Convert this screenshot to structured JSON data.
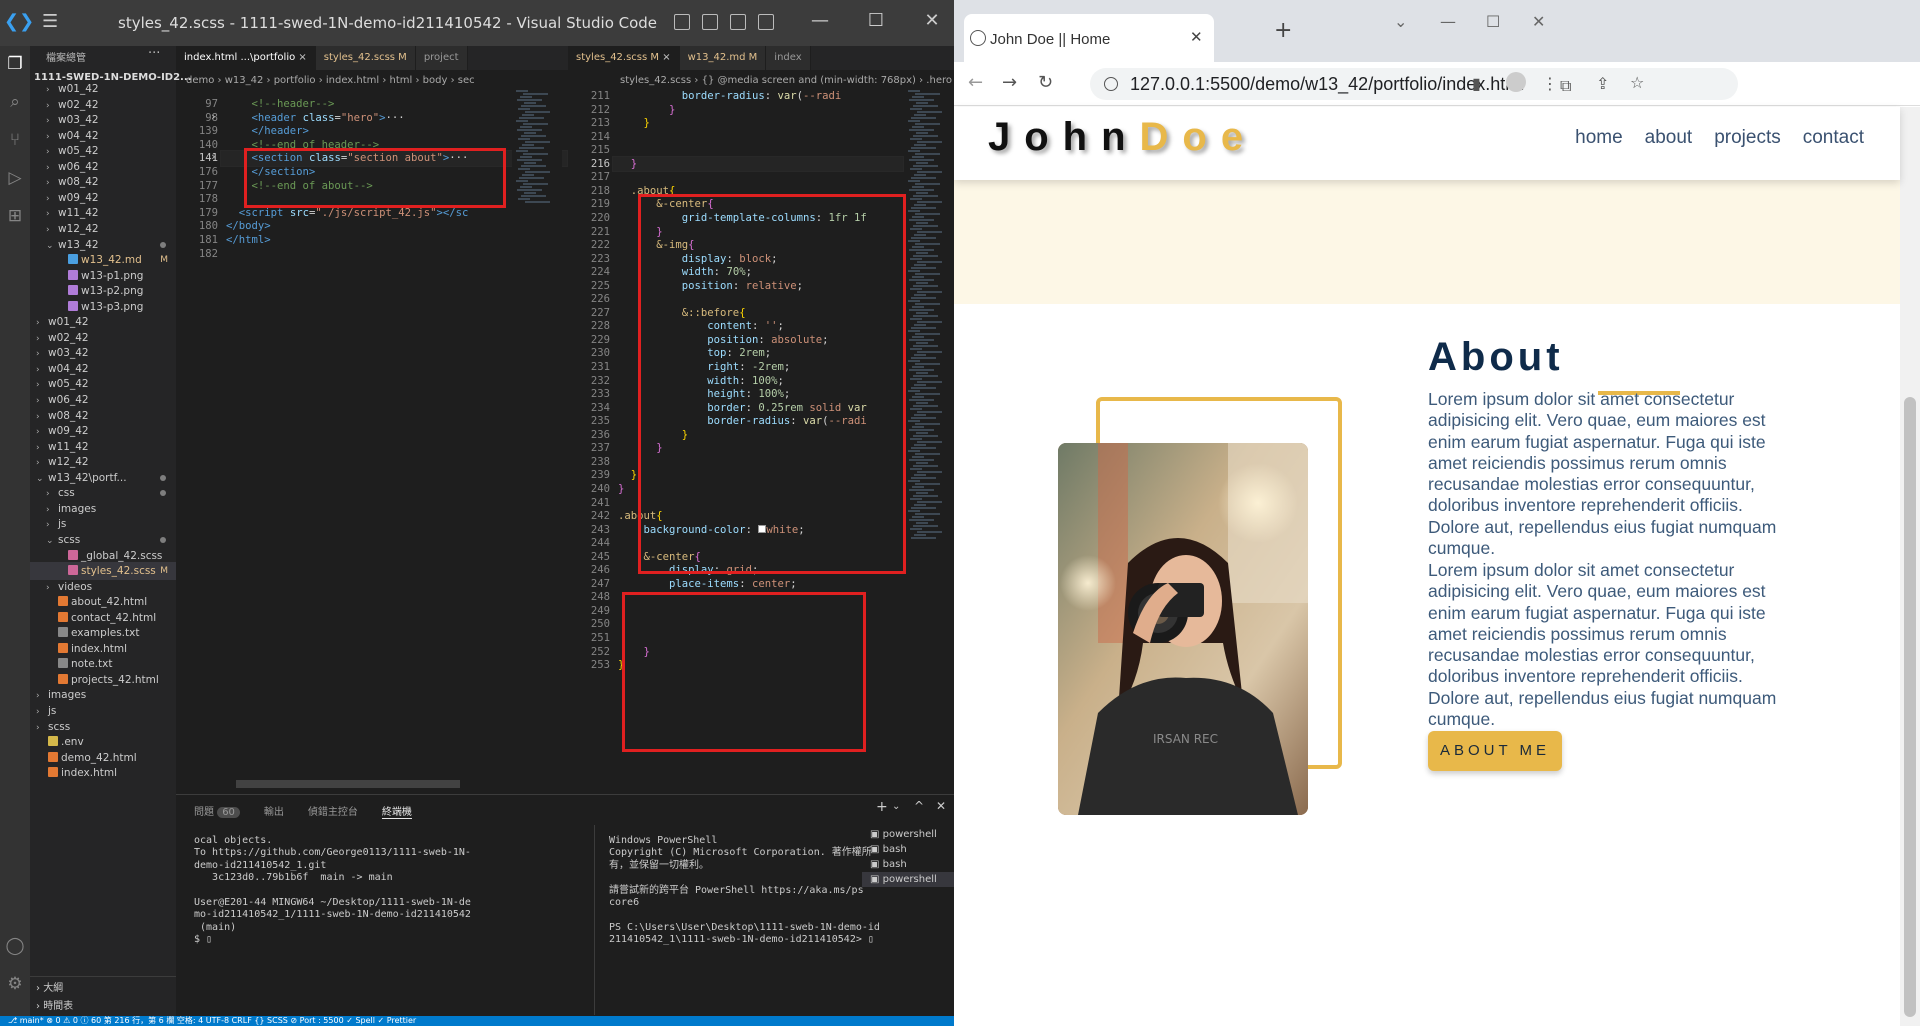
{
  "vscode": {
    "window_title": "styles_42.scss - 1111-swed-1N-demo-id211410542 - Visual Studio Code",
    "explorer_header": "檔案總管",
    "project_name": "1111-SWED-1N-DEMO-ID2...",
    "tree": [
      {
        "label": "w01_42",
        "indent": 1,
        "chev": ">"
      },
      {
        "label": "w02_42",
        "indent": 1,
        "chev": ">"
      },
      {
        "label": "w03_42",
        "indent": 1,
        "chev": ">"
      },
      {
        "label": "w04_42",
        "indent": 1,
        "chev": ">"
      },
      {
        "label": "w05_42",
        "indent": 1,
        "chev": ">"
      },
      {
        "label": "w06_42",
        "indent": 1,
        "chev": ">"
      },
      {
        "label": "w08_42",
        "indent": 1,
        "chev": ">"
      },
      {
        "label": "w09_42",
        "indent": 1,
        "chev": ">"
      },
      {
        "label": "w11_42",
        "indent": 1,
        "chev": ">"
      },
      {
        "label": "w12_42",
        "indent": 1,
        "chev": ">"
      },
      {
        "label": "w13_42",
        "indent": 1,
        "chev": "v",
        "dot": true
      },
      {
        "label": "w13_42.md",
        "indent": 2,
        "chev": "",
        "mod": true,
        "badge": "M",
        "icon": "#4a9fe0"
      },
      {
        "label": "w13-p1.png",
        "indent": 2,
        "chev": "",
        "icon": "#b07cd8"
      },
      {
        "label": "w13-p2.png",
        "indent": 2,
        "chev": "",
        "icon": "#b07cd8"
      },
      {
        "label": "w13-p3.png",
        "indent": 2,
        "chev": "",
        "icon": "#b07cd8"
      },
      {
        "label": "w01_42",
        "indent": 0,
        "chev": ">"
      },
      {
        "label": "w02_42",
        "indent": 0,
        "chev": ">"
      },
      {
        "label": "w03_42",
        "indent": 0,
        "chev": ">"
      },
      {
        "label": "w04_42",
        "indent": 0,
        "chev": ">"
      },
      {
        "label": "w05_42",
        "indent": 0,
        "chev": ">"
      },
      {
        "label": "w06_42",
        "indent": 0,
        "chev": ">"
      },
      {
        "label": "w08_42",
        "indent": 0,
        "chev": ">"
      },
      {
        "label": "w09_42",
        "indent": 0,
        "chev": ">"
      },
      {
        "label": "w11_42",
        "indent": 0,
        "chev": ">"
      },
      {
        "label": "w12_42",
        "indent": 0,
        "chev": ">"
      },
      {
        "label": "w13_42\\portf...",
        "indent": 0,
        "chev": "v",
        "dot": true
      },
      {
        "label": "css",
        "indent": 1,
        "chev": ">",
        "dot": true
      },
      {
        "label": "images",
        "indent": 1,
        "chev": ">"
      },
      {
        "label": "js",
        "indent": 1,
        "chev": ">"
      },
      {
        "label": "scss",
        "indent": 1,
        "chev": "v",
        "dot": true
      },
      {
        "label": "_global_42.scss",
        "indent": 2,
        "chev": "",
        "icon": "#cd6799"
      },
      {
        "label": "styles_42.scss",
        "indent": 2,
        "chev": "",
        "mod": true,
        "badge": "M",
        "sel": true,
        "icon": "#cd6799"
      },
      {
        "label": "videos",
        "indent": 1,
        "chev": ">"
      },
      {
        "label": "about_42.html",
        "indent": 1,
        "chev": "",
        "icon": "#e37933"
      },
      {
        "label": "contact_42.html",
        "indent": 1,
        "chev": "",
        "icon": "#e37933"
      },
      {
        "label": "examples.txt",
        "indent": 1,
        "chev": "",
        "icon": "#888"
      },
      {
        "label": "index.html",
        "indent": 1,
        "chev": "",
        "icon": "#e37933"
      },
      {
        "label": "note.txt",
        "indent": 1,
        "chev": "",
        "icon": "#888"
      },
      {
        "label": "projects_42.html",
        "indent": 1,
        "chev": "",
        "icon": "#e37933"
      },
      {
        "label": "images",
        "indent": 0,
        "chev": ">"
      },
      {
        "label": "js",
        "indent": 0,
        "chev": ">"
      },
      {
        "label": "scss",
        "indent": 0,
        "chev": ">"
      },
      {
        "label": ".env",
        "indent": 0,
        "chev": "",
        "icon": "#d4b84a"
      },
      {
        "label": "demo_42.html",
        "indent": 0,
        "chev": "",
        "icon": "#e37933"
      },
      {
        "label": "index.html",
        "indent": 0,
        "chev": "",
        "icon": "#e37933"
      }
    ],
    "outline_label": "大綱",
    "timeline_label": "時間表",
    "left_tabs": [
      {
        "label": "index.html ...\\portfolio",
        "active": true,
        "close": "×"
      },
      {
        "label": "styles_42.scss M",
        "mod": true
      },
      {
        "label": "project"
      }
    ],
    "right_tabs": [
      {
        "label": "styles_42.scss M",
        "active": true,
        "mod": true,
        "close": "×"
      },
      {
        "label": "w13_42.md M",
        "mod": true
      },
      {
        "label": "index"
      }
    ],
    "left_crumb": "demo › w13_42 › portfolio › index.html › html › body › sec",
    "right_crumb": "styles_42.scss › {} @media screen and (min-width: 768px) › .hero",
    "left_lines": [
      {
        "n": "97",
        "html": "    <span class='cm'>&lt;!--header--&gt;</span>"
      },
      {
        "n": "98",
        "html": "    <span class='tg'>&lt;header</span> <span class='at'>class</span>=<span class='st'>\"hero\"</span><span class='tg'>&gt;</span>···"
      },
      {
        "n": "139",
        "html": "    <span class='tg'>&lt;/header&gt;</span>"
      },
      {
        "n": "140",
        "html": "    <span class='cm'>&lt;!--end of header--&gt;</span>"
      },
      {
        "n": "141",
        "html": "    <span class='tg'>&lt;section</span> <span class='at'>class</span>=<span class='st'>\"section about\"</span><span class='tg'>&gt;</span>···",
        "cur": true
      },
      {
        "n": "176",
        "html": "    <span class='tg'>&lt;/section&gt;</span>"
      },
      {
        "n": "177",
        "html": "    <span class='cm'>&lt;!--end of about--&gt;</span>"
      },
      {
        "n": "178",
        "html": ""
      },
      {
        "n": "179",
        "html": "  <span class='tg'>&lt;script</span> <span class='at'>src</span>=<span class='st'>\"./js/script_42.js\"</span><span class='tg'>&gt;&lt;/sc</span>"
      },
      {
        "n": "180",
        "html": "<span class='tg'>&lt;/body&gt;</span>"
      },
      {
        "n": "181",
        "html": "<span class='tg'>&lt;/html&gt;</span>"
      },
      {
        "n": "182",
        "html": ""
      }
    ],
    "right_lines": [
      {
        "n": "211",
        "html": "          <span class='pr'>border-radius</span>: <span class='fn'>var</span>(<span class='vl'>--radi</span>"
      },
      {
        "n": "212",
        "html": "        <span class='pu'>}</span>"
      },
      {
        "n": "213",
        "html": "    <span class='br'>}</span>"
      },
      {
        "n": "214",
        "html": ""
      },
      {
        "n": "215",
        "html": ""
      },
      {
        "n": "216",
        "html": "  <span class='pu'>}</span>",
        "cur": true
      },
      {
        "n": "217",
        "html": ""
      },
      {
        "n": "218",
        "html": "  <span class='sel2'>.about</span><span class='br'>{</span>"
      },
      {
        "n": "219",
        "html": "      <span class='sel2'>&amp;-center</span><span class='pu'>{</span>"
      },
      {
        "n": "220",
        "html": "          <span class='pr'>grid-template-columns</span>: <span class='nm'>1fr 1f</span>"
      },
      {
        "n": "221",
        "html": "      <span class='pu'>}</span>"
      },
      {
        "n": "222",
        "html": "      <span class='sel2'>&amp;-img</span><span class='pu'>{</span>"
      },
      {
        "n": "223",
        "html": "          <span class='pr'>display</span>: <span class='vl'>block</span>;"
      },
      {
        "n": "224",
        "html": "          <span class='pr'>width</span>: <span class='nm'>70%</span>;"
      },
      {
        "n": "225",
        "html": "          <span class='pr'>position</span>: <span class='vl'>relative</span>;"
      },
      {
        "n": "226",
        "html": ""
      },
      {
        "n": "227",
        "html": "          <span class='sel2'>&amp;::before</span><span class='br'>{</span>"
      },
      {
        "n": "228",
        "html": "              <span class='pr'>content</span>: <span class='st'>''</span>;"
      },
      {
        "n": "229",
        "html": "              <span class='pr'>position</span>: <span class='vl'>absolute</span>;"
      },
      {
        "n": "230",
        "html": "              <span class='pr'>top</span>: <span class='nm'>2rem</span>;"
      },
      {
        "n": "231",
        "html": "              <span class='pr'>right</span>: <span class='nm'>-2rem</span>;"
      },
      {
        "n": "232",
        "html": "              <span class='pr'>width</span>: <span class='nm'>100%</span>;"
      },
      {
        "n": "233",
        "html": "              <span class='pr'>height</span>: <span class='nm'>100%</span>;"
      },
      {
        "n": "234",
        "html": "              <span class='pr'>border</span>: <span class='nm'>0.25rem</span> <span class='vl'>solid</span> <span class='fn'>var</span>"
      },
      {
        "n": "235",
        "html": "              <span class='pr'>border-radius</span>: <span class='fn'>var</span>(<span class='vl'>--radi</span>"
      },
      {
        "n": "236",
        "html": "          <span class='br'>}</span>"
      },
      {
        "n": "237",
        "html": "      <span class='pu'>}</span>"
      },
      {
        "n": "238",
        "html": ""
      },
      {
        "n": "239",
        "html": "  <span class='br'>}</span>"
      },
      {
        "n": "240",
        "html": "<span class='pu'>}</span>"
      },
      {
        "n": "241",
        "html": ""
      },
      {
        "n": "242",
        "html": "<span class='sel2'>.about</span><span class='br'>{</span>"
      },
      {
        "n": "243",
        "html": "    <span class='pr'>background-color</span>: <span style='display:inline-block;width:8px;height:8px;background:#fff;border:1px solid #999'></span><span class='vl'>white</span>;"
      },
      {
        "n": "244",
        "html": ""
      },
      {
        "n": "245",
        "html": "    <span class='sel2'>&amp;-center</span><span class='pu'>{</span>"
      },
      {
        "n": "246",
        "html": "        <span class='pr'>display</span>: <span class='vl'>grid</span>;"
      },
      {
        "n": "247",
        "html": "        <span class='pr'>place-items</span>: <span class='vl'>center</span>;"
      },
      {
        "n": "248",
        "html": ""
      },
      {
        "n": "249",
        "html": ""
      },
      {
        "n": "250",
        "html": ""
      },
      {
        "n": "251",
        "html": ""
      },
      {
        "n": "252",
        "html": "    <span class='pu'>}</span>"
      },
      {
        "n": "253",
        "html": "<span class='br'>}</span>"
      }
    ],
    "panel_tabs": [
      "問題",
      "60",
      "輸出",
      "偵錯主控台",
      "終端機"
    ],
    "term_left": "ocal objects.\nTo https://github.com/George0113/1111-sweb-1N-\ndemo-id211410542_1.git\n   3c123d0..79b1b6f  main -> main\n\nUser@E201-44 MINGW64 ~/Desktop/1111-sweb-1N-de\nmo-id211410542_1/1111-sweb-1N-demo-id211410542\n (main)\n$ ▯",
    "term_right": "Windows PowerShell\nCopyright (C) Microsoft Corporation. 著作權所\n有，並保留一切權利。\n\n請嘗試新的跨平台 PowerShell https://aka.ms/ps\ncore6\n\nPS C:\\Users\\User\\Desktop\\1111-sweb-1N-demo-id\n211410542_1\\1111-sweb-1N-demo-id211410542> ▯",
    "term_list": [
      "powershell",
      "bash",
      "bash",
      "powershell"
    ],
    "status": "⎇ main*   ⊗ 0 ⚠ 0  ⓘ 60                                                                        第 216 行，第 6 欄   空格: 4   UTF-8   CRLF   {} SCSS   ⊘ Port : 5500   ✓ Spell   ✓ Prettier"
  },
  "browser": {
    "tab_title": "John Doe || Home",
    "url": "127.0.0.1:5500/demo/w13_42/portfolio/index.html",
    "site": {
      "logo_first": "John",
      "logo_last": "Doe",
      "nav": [
        "home",
        "about",
        "projects",
        "contact"
      ],
      "about_title": "About",
      "para1": "Lorem ipsum dolor sit amet consectetur adipisicing elit. Vero quae, eum maiores est enim earum fugiat aspernatur. Fuga qui iste amet reiciendis possimus rerum omnis recusandae molestias error consequuntur, doloribus inventore reprehenderit officiis. Dolore aut, repellendus eius fugiat numquam cumque.",
      "para2": "Lorem ipsum dolor sit amet consectetur adipisicing elit. Vero quae, eum maiores est enim earum fugiat aspernatur. Fuga qui iste amet reiciendis possimus rerum omnis recusandae molestias error consequuntur, doloribus inventore reprehenderit officiis. Dolore aut, repellendus eius fugiat numquam cumque.",
      "button": "ABOUT ME"
    },
    "colors": {
      "accent": "#e8b84a",
      "navy": "#0f2b4a",
      "hero_band": "#fdf7e6"
    }
  }
}
